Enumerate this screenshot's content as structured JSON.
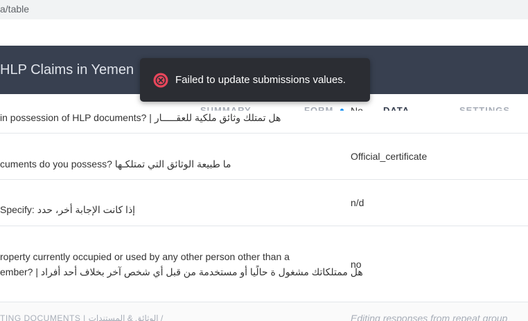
{
  "browser": {
    "url_fragment": "a/table"
  },
  "header": {
    "title": "HLP Claims in Yemen"
  },
  "tabs": [
    {
      "label": "SUMMARY",
      "active": false
    },
    {
      "label": "FORM",
      "active": false
    },
    {
      "label": "DATA",
      "active": true
    },
    {
      "label": "SETTINGS",
      "active": false
    }
  ],
  "rows": [
    {
      "question": "in possession of HLP documents? | هل تمتلك وثائق ملكية للعقـــــار",
      "answer": "No"
    },
    {
      "question": "cuments do you possess? ما طبيعة الوثائق التي تمتلكـها",
      "answer": "Official_certificate"
    },
    {
      "question": "Specify: إذا كانت الإجابة أخر، حدد",
      "answer": "n/d"
    },
    {
      "question_line1": "roperty currently occupied or used by any other person other than a",
      "question_line2": "ember? | هل ممتلكاتك مشغول ة حالًيا أو مستخدمة من قبل أي شخص آخر بخلاف أحد أفراد",
      "answer": "no"
    }
  ],
  "group": {
    "title": "TING DOCUMENTS | الوثائق & المستندات /",
    "note": "Editing responses from repeat group"
  },
  "toast": {
    "message": "Failed to update submissions values.",
    "icon": "error-circle-icon",
    "icon_color": "#e8465b"
  },
  "colors": {
    "header_bg": "#384050",
    "toast_bg": "#2b2d33",
    "accent": "#2196f3"
  }
}
